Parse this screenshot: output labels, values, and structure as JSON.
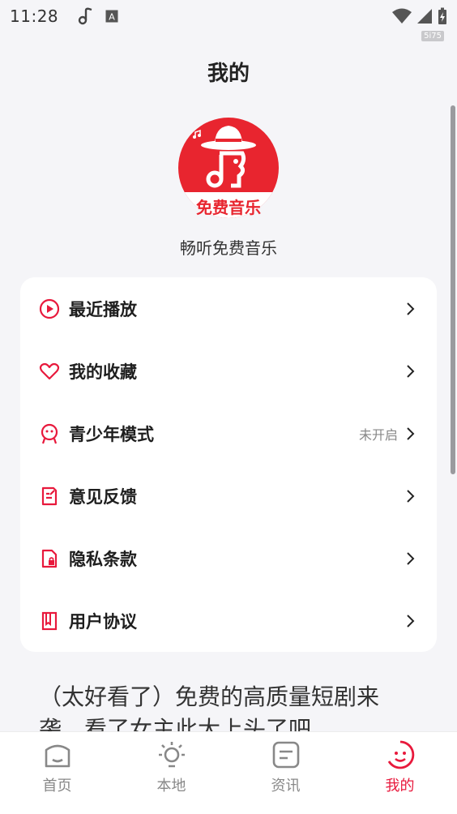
{
  "status_bar": {
    "time": "11:28",
    "speed": "5i75"
  },
  "page": {
    "title": "我的",
    "app_name": "畅听免费音乐",
    "logo_text": "免费音乐"
  },
  "menu": {
    "items": [
      {
        "label": "最近播放",
        "status": "",
        "icon": "play-circle-icon"
      },
      {
        "label": "我的收藏",
        "status": "",
        "icon": "heart-icon"
      },
      {
        "label": "青少年模式",
        "status": "未开启",
        "icon": "youth-mode-icon"
      },
      {
        "label": "意见反馈",
        "status": "",
        "icon": "feedback-icon"
      },
      {
        "label": "隐私条款",
        "status": "",
        "icon": "privacy-icon"
      },
      {
        "label": "用户协议",
        "status": "",
        "icon": "agreement-icon"
      }
    ]
  },
  "promo": {
    "text": "（太好看了）免费的高质量短剧来袭，看了女主此大上头了吧"
  },
  "tabs": [
    {
      "label": "首页",
      "icon": "home-icon",
      "active": false
    },
    {
      "label": "本地",
      "icon": "bulb-icon",
      "active": false
    },
    {
      "label": "资讯",
      "icon": "news-icon",
      "active": false
    },
    {
      "label": "我的",
      "icon": "profile-face-icon",
      "active": true
    }
  ],
  "colors": {
    "accent": "#e8193c",
    "background": "#f5f5f8",
    "card": "#ffffff"
  }
}
